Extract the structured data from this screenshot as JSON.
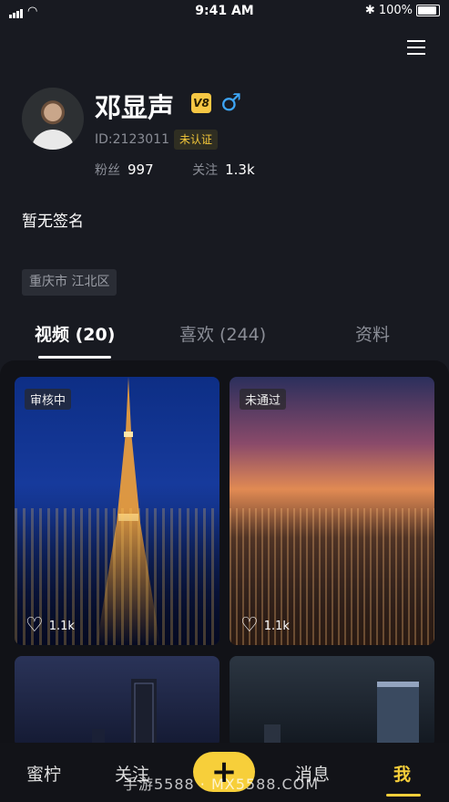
{
  "status_bar": {
    "time": "9:41 AM",
    "battery": "100%"
  },
  "profile": {
    "name": "邓显声",
    "vip_level": "V8",
    "gender_symbol": "♂",
    "id_text": "ID:2123011",
    "verify_badge": "未认证",
    "fans_label": "粉丝",
    "fans_count": "997",
    "following_label": "关注",
    "following_count": "1.3k",
    "signature": "暂无签名",
    "location": "重庆市 江北区"
  },
  "tabs": [
    {
      "label": "视频 (20)",
      "active": true
    },
    {
      "label": "喜欢 (244)",
      "active": false
    },
    {
      "label": "资料",
      "active": false
    }
  ],
  "videos": [
    {
      "status": "审核中",
      "likes": "1.1k"
    },
    {
      "status": "未通过",
      "likes": "1.1k"
    },
    {
      "status": "",
      "likes": ""
    },
    {
      "status": "",
      "likes": ""
    }
  ],
  "bottom_nav": [
    {
      "label": "蜜柠",
      "active": false
    },
    {
      "label": "关注",
      "active": false
    },
    {
      "label": "+",
      "active": false
    },
    {
      "label": "消息",
      "active": false
    },
    {
      "label": "我",
      "active": true
    }
  ],
  "watermark": "手游5588 · MX5588.COM",
  "colors": {
    "accent": "#f7cf3a",
    "gender": "#3da5f5",
    "background": "#181a21"
  },
  "icons": [
    "signal-icon",
    "wifi-icon",
    "bluetooth-icon",
    "battery-icon",
    "menu-icon",
    "heart-icon",
    "plus-icon"
  ]
}
